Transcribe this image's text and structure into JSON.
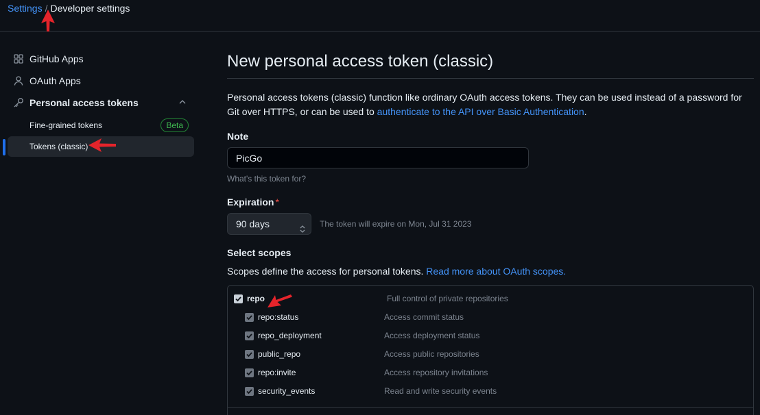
{
  "breadcrumb": {
    "root": "Settings",
    "separator": "/",
    "current": "Developer settings"
  },
  "sidebar": {
    "items": [
      {
        "label": "GitHub Apps",
        "icon": "apps-grid-icon"
      },
      {
        "label": "OAuth Apps",
        "icon": "person-icon"
      },
      {
        "label": "Personal access tokens",
        "icon": "key-icon"
      }
    ],
    "sub_items": [
      {
        "label": "Fine-grained tokens",
        "badge": "Beta"
      },
      {
        "label": "Tokens (classic)"
      }
    ]
  },
  "main": {
    "title": "New personal access token (classic)",
    "description_text": "Personal access tokens (classic) function like ordinary OAuth access tokens. They can be used instead of a password for Git over HTTPS, or can be used to ",
    "description_link": "authenticate to the API over Basic Authentication",
    "description_end": ".",
    "note": {
      "label": "Note",
      "value": "PicGo",
      "hint": "What's this token for?"
    },
    "expiration": {
      "label": "Expiration",
      "required_mark": "*",
      "selected": "90 days",
      "note": "The token will expire on Mon, Jul 31 2023"
    },
    "scopes": {
      "label": "Select scopes",
      "desc_text": "Scopes define the access for personal tokens. ",
      "desc_link": "Read more about OAuth scopes.",
      "rows": [
        {
          "name": "repo",
          "description": "Full control of private repositories",
          "checked": true,
          "level": 0
        },
        {
          "name": "repo:status",
          "description": "Access commit status",
          "checked": true,
          "level": 1
        },
        {
          "name": "repo_deployment",
          "description": "Access deployment status",
          "checked": true,
          "level": 1
        },
        {
          "name": "public_repo",
          "description": "Access public repositories",
          "checked": true,
          "level": 1
        },
        {
          "name": "repo:invite",
          "description": "Access repository invitations",
          "checked": true,
          "level": 1
        },
        {
          "name": "security_events",
          "description": "Read and write security events",
          "checked": true,
          "level": 1
        }
      ]
    }
  },
  "colors": {
    "background": "#0d1117",
    "link": "#4493f8",
    "annotation_arrow": "#e5242b",
    "beta": "#3fb950"
  }
}
